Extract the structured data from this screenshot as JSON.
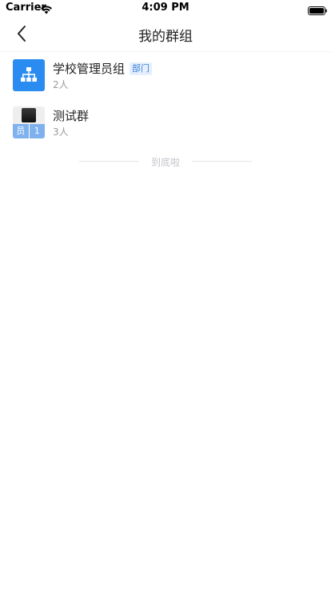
{
  "status_bar": {
    "carrier": "Carrier",
    "time": "4:09 PM",
    "wifi_icon": "wifi-icon",
    "battery_icon": "battery-icon"
  },
  "nav": {
    "title": "我的群组",
    "back_icon": "chevron-left-icon"
  },
  "groups": [
    {
      "name": "学校管理员组",
      "tag": "部门",
      "members": "2人",
      "avatar_icon": "org-chart-icon"
    },
    {
      "name": "测试群",
      "members": "3人",
      "avatar_cells": [
        "员",
        "1"
      ]
    }
  ],
  "footer": {
    "end_text": "到底啦"
  },
  "colors": {
    "accent": "#2a8cf0",
    "tag_text": "#3a7fdc",
    "tag_bg": "#e6f0fc",
    "muted": "#999999"
  }
}
